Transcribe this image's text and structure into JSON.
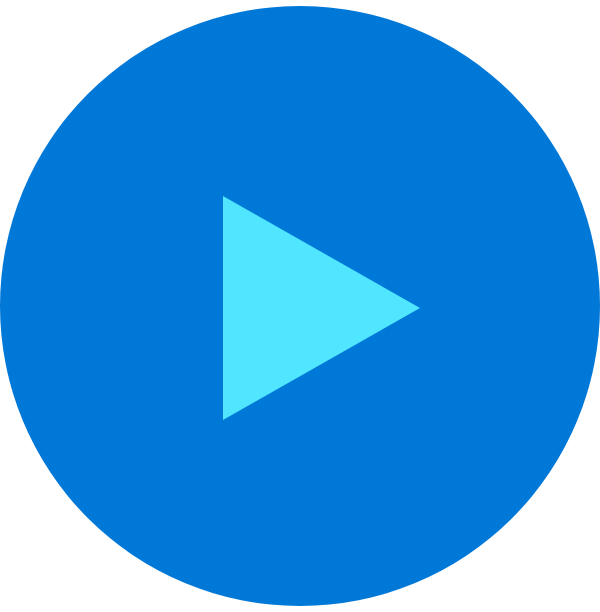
{
  "play_button": {
    "icon": "play-icon",
    "circle_color": "#0078D7",
    "triangle_color": "#50E6FF"
  }
}
